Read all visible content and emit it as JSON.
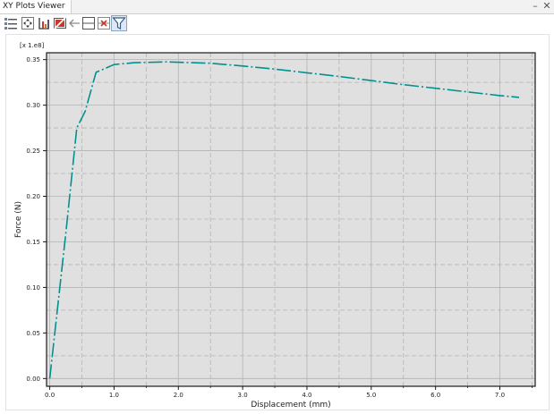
{
  "window": {
    "tab_title": "XY Plots Viewer",
    "minimize_glyph": "–",
    "close_glyph": "✕"
  },
  "toolbar": {
    "buttons": [
      {
        "icon": "list-options-icon"
      },
      {
        "icon": "fit-view-icon"
      },
      {
        "icon": "axis-scale-icon"
      },
      {
        "icon": "no-selection-icon"
      },
      {
        "icon": "back-arrow-icon"
      },
      {
        "icon": "split-layout-icon"
      },
      {
        "icon": "delete-plot-icon"
      },
      {
        "icon": "filter-icon",
        "selected": true
      }
    ]
  },
  "chart_data": {
    "type": "line",
    "title": "",
    "xlabel": "Displacement (mm)",
    "ylabel": "Force (N)",
    "y_multiplier_label": "[x 1.e8]",
    "xlim": [
      -0.05,
      7.55
    ],
    "ylim": [
      -0.0085,
      0.3575
    ],
    "x_ticks": [
      0.0,
      1.0,
      2.0,
      3.0,
      4.0,
      5.0,
      6.0,
      7.0
    ],
    "x_tick_labels": [
      "0.0",
      "1.0",
      "2.0",
      "3.0",
      "4.0",
      "5.0",
      "6.0",
      "7.0"
    ],
    "y_ticks": [
      0.0,
      0.05,
      0.1,
      0.15,
      0.2,
      0.25,
      0.3,
      0.35
    ],
    "y_tick_labels": [
      "0.00",
      "0.05",
      "0.10",
      "0.15",
      "0.20",
      "0.25",
      "0.30",
      "0.35"
    ],
    "x_minor_grid": [
      0.5,
      1.5,
      2.5,
      3.5,
      4.5,
      5.5,
      6.5,
      7.5
    ],
    "y_minor_grid": [
      0.025,
      0.075,
      0.125,
      0.175,
      0.225,
      0.275,
      0.325
    ],
    "grid": true,
    "background": "#e0e0e0",
    "series": [
      {
        "color": "#00918f",
        "line_style": "dash-dot",
        "x": [
          0.0,
          0.25,
          0.42,
          0.55,
          0.72,
          1.0,
          1.3,
          1.8,
          2.5,
          3.0,
          3.5,
          4.0,
          4.5,
          5.0,
          5.5,
          6.0,
          6.5,
          7.0,
          7.3
        ],
        "y": [
          0.0,
          0.16,
          0.275,
          0.293,
          0.336,
          0.3445,
          0.3465,
          0.3475,
          0.346,
          0.343,
          0.3395,
          0.3355,
          0.3315,
          0.327,
          0.3225,
          0.3185,
          0.3145,
          0.3105,
          0.3085
        ]
      }
    ]
  }
}
